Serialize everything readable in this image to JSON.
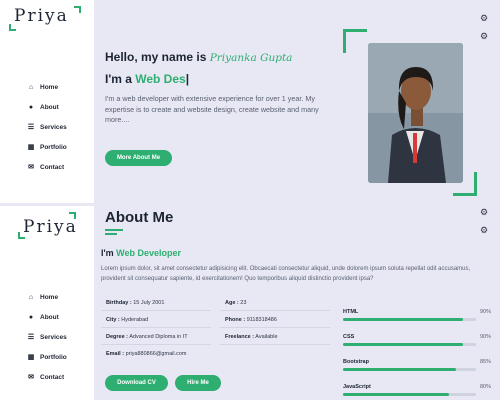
{
  "brand": {
    "logo": "Priya"
  },
  "nav": [
    {
      "icon": "home-icon",
      "glyph": "⌂",
      "label": "Home"
    },
    {
      "icon": "user-icon",
      "glyph": "●",
      "label": "About"
    },
    {
      "icon": "list-icon",
      "glyph": "☰",
      "label": "Services"
    },
    {
      "icon": "portfolio-icon",
      "glyph": "▦",
      "label": "Portfolio"
    },
    {
      "icon": "chat-icon",
      "glyph": "✉",
      "label": "Contact"
    }
  ],
  "hero": {
    "greeting": "Hello, my name is",
    "name": "Priyanka Gupta",
    "role_prefix": "I'm a",
    "role_typed": "Web Des",
    "cursor": "|",
    "description": "I'm a web developer with extensive experience for over 1 year. My expertise is to create and website design, create website and many more....",
    "button": "More About Me"
  },
  "about": {
    "title": "About Me",
    "role_prefix": "I'm",
    "role": "Web Developer",
    "description": "Lorem ipsum dolor, sit amet consectetur adipisicing elit. Obcaecati consectetur aliquid, unde dolorem ipsum soluta repellat odit accusamus, provident sit consequatur sapiente, id exercitationem! Quo temporibus aliquid distinctio provident ipsa?",
    "details_left": [
      {
        "label": "Birthday :",
        "value": "15 July 2001"
      },
      {
        "label": "City :",
        "value": "Hyderabad"
      },
      {
        "label": "Degree :",
        "value": "Advanced Diploma in IT"
      },
      {
        "label": "Email :",
        "value": "priya880866@gmail.com"
      }
    ],
    "details_right": [
      {
        "label": "Age :",
        "value": "23"
      },
      {
        "label": "Phone :",
        "value": "9118318486"
      },
      {
        "label": "Freelance :",
        "value": "Available"
      }
    ],
    "download_button": "Download CV",
    "hire_button": "Hire Me",
    "skills": [
      {
        "name": "HTML",
        "percent_label": "90%",
        "level": 0.9
      },
      {
        "name": "CSS",
        "percent_label": "90%",
        "level": 0.9
      },
      {
        "name": "Bootstrap",
        "percent_label": "85%",
        "level": 0.85
      },
      {
        "name": "JavaScript",
        "percent_label": "80%",
        "level": 0.8
      }
    ]
  },
  "colors": {
    "accent": "#2eaf71",
    "background": "#e7e8f3",
    "sidebar": "#ffffff",
    "text": "#1d2433"
  },
  "icons": {
    "settings": "gear-icon",
    "settings_secondary": "gear-icon"
  }
}
